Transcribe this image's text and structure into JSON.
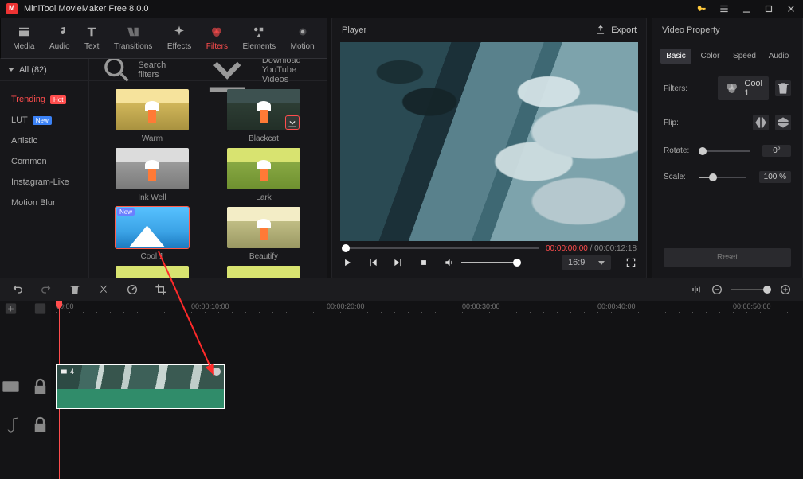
{
  "app": {
    "title": "MiniTool MovieMaker Free 8.0.0"
  },
  "toolbar": {
    "items": [
      {
        "label": "Media",
        "name": "media"
      },
      {
        "label": "Audio",
        "name": "audio"
      },
      {
        "label": "Text",
        "name": "text"
      },
      {
        "label": "Transitions",
        "name": "transitions"
      },
      {
        "label": "Effects",
        "name": "effects"
      },
      {
        "label": "Filters",
        "name": "filters"
      },
      {
        "label": "Elements",
        "name": "elements"
      },
      {
        "label": "Motion",
        "name": "motion"
      }
    ],
    "active": 5
  },
  "sidebar": {
    "header": "All (82)",
    "items": [
      {
        "label": "Trending",
        "badge": "Hot",
        "badgeClass": "hot"
      },
      {
        "label": "LUT",
        "badge": "New",
        "badgeClass": "new"
      },
      {
        "label": "Artistic"
      },
      {
        "label": "Common"
      },
      {
        "label": "Instagram-Like"
      },
      {
        "label": "Motion Blur"
      }
    ],
    "active": 0
  },
  "gridbar": {
    "search": "Search filters",
    "download": "Download YouTube Videos"
  },
  "filters": [
    {
      "name": "Warm",
      "scene": "sc-warm"
    },
    {
      "name": "Blackcat",
      "scene": "sc-dark",
      "download": true,
      "dl_hl": true
    },
    {
      "name": "Ink Well",
      "scene": "sc-bw"
    },
    {
      "name": "Lark",
      "scene": "sc-field"
    },
    {
      "name": "Cool 1",
      "scene": "sc-cool1",
      "selected": true,
      "new": true
    },
    {
      "name": "Beautify",
      "scene": "sc-beautify"
    },
    {
      "name": "",
      "scene": "sc-field"
    },
    {
      "name": "",
      "scene": "sc-field"
    }
  ],
  "player": {
    "title": "Player",
    "export": "Export",
    "current": "00:00:00:00",
    "total": "00:00:12:18",
    "ratio": "16:9"
  },
  "props": {
    "title": "Video Property",
    "tabs": [
      "Basic",
      "Color",
      "Speed",
      "Audio"
    ],
    "active": 0,
    "filters_label": "Filters:",
    "filter_name": "Cool 1",
    "flip_label": "Flip:",
    "rotate_label": "Rotate:",
    "rotate_value": "0°",
    "scale_label": "Scale:",
    "scale_value": "100 %",
    "reset": "Reset"
  },
  "timeline": {
    "ticks": [
      "00:00",
      "00:00:10:00",
      "00:00:20:00",
      "00:00:30:00",
      "00:00:40:00",
      "00:00:50:00"
    ],
    "clip_label": "4"
  }
}
